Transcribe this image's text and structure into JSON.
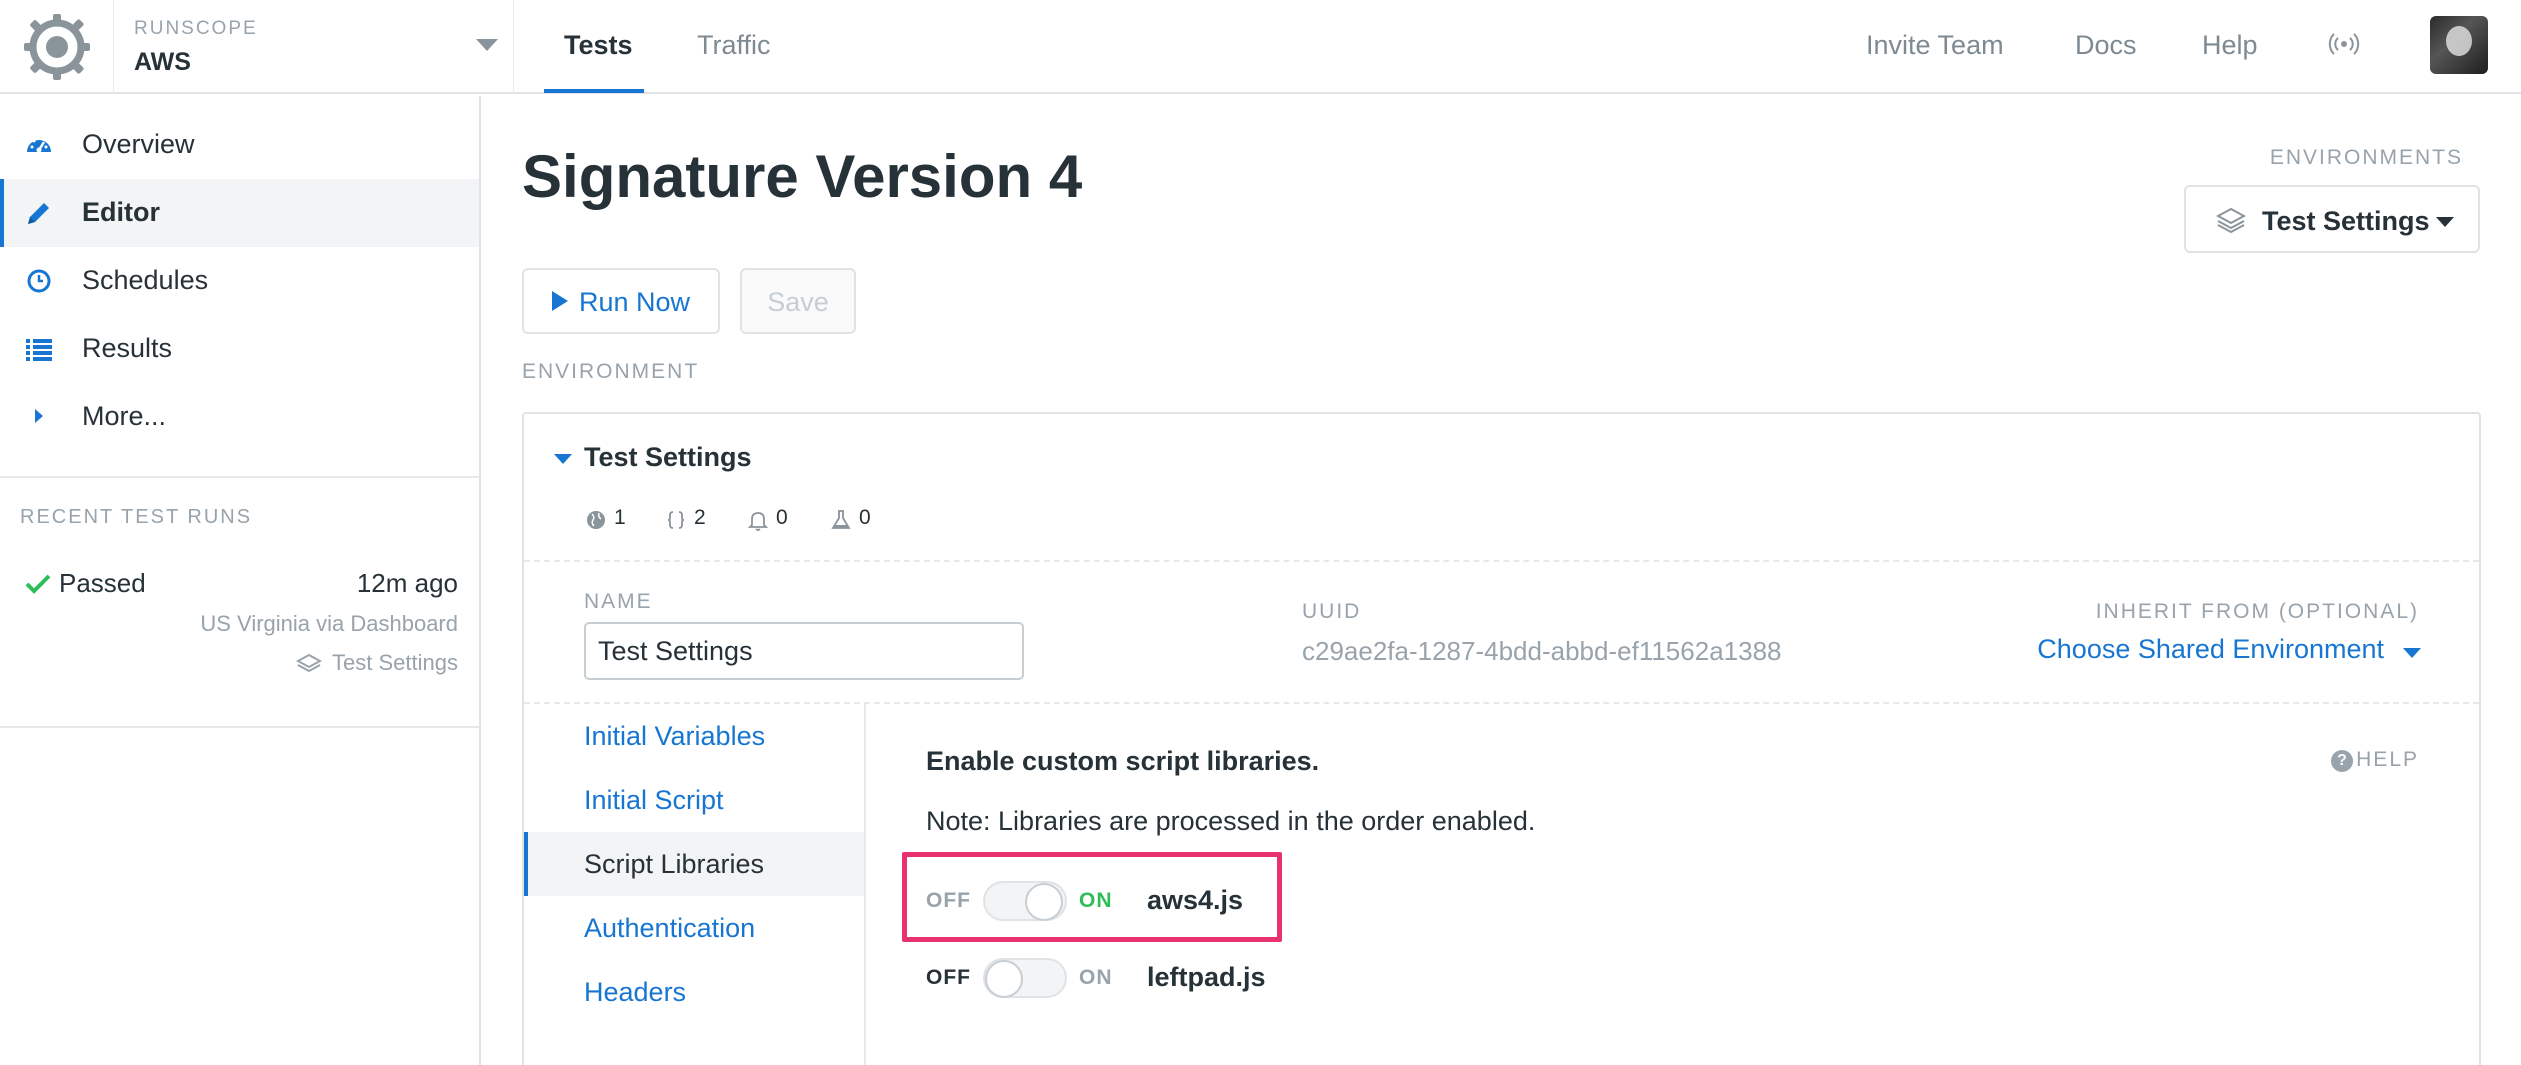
{
  "topbar": {
    "brand_small": "RUNSCOPE",
    "bucket_name": "AWS",
    "tabs": [
      {
        "label": "Tests",
        "active": true
      },
      {
        "label": "Traffic",
        "active": false
      }
    ],
    "links": {
      "invite": "Invite Team",
      "docs": "Docs",
      "help": "Help"
    }
  },
  "sidebar": {
    "items": [
      {
        "label": "Overview",
        "icon": "dashboard-icon"
      },
      {
        "label": "Editor",
        "icon": "pencil-icon",
        "active": true
      },
      {
        "label": "Schedules",
        "icon": "clock-icon"
      },
      {
        "label": "Results",
        "icon": "list-icon"
      },
      {
        "label": "More...",
        "icon": "caret-right-icon"
      }
    ],
    "recent_title": "RECENT TEST RUNS",
    "recent_run": {
      "status": "Passed",
      "time": "12m ago",
      "location": "US Virginia via Dashboard",
      "environment": "Test Settings"
    }
  },
  "main": {
    "title": "Signature Version 4",
    "environments_label": "ENVIRONMENTS",
    "env_select": "Test Settings",
    "run_label": "Run Now",
    "save_label": "Save",
    "environment_section": "ENVIRONMENT"
  },
  "panel": {
    "title": "Test Settings",
    "stats": {
      "regions": "1",
      "variables": "2",
      "notifications": "0",
      "tests": "0"
    },
    "name_label": "NAME",
    "name_value": "Test Settings",
    "uuid_label": "UUID",
    "uuid_value": "c29ae2fa-1287-4bdd-abbd-ef11562a1388",
    "inherit_label": "INHERIT FROM (OPTIONAL)",
    "inherit_link": "Choose Shared Environment",
    "subnav": [
      {
        "label": "Initial Variables"
      },
      {
        "label": "Initial Script"
      },
      {
        "label": "Script Libraries",
        "active": true
      },
      {
        "label": "Authentication"
      },
      {
        "label": "Headers"
      }
    ],
    "content_title": "Enable custom script libraries.",
    "help_label": "HELP",
    "note": "Note: Libraries are processed in the order enabled.",
    "libraries": [
      {
        "name": "aws4.js",
        "off_label": "OFF",
        "on_label": "ON",
        "enabled": true
      },
      {
        "name": "leftpad.js",
        "off_label": "OFF",
        "on_label": "ON",
        "enabled": false
      }
    ]
  },
  "colors": {
    "accent": "#1776d1",
    "success": "#2ebd59",
    "highlight": "#e8326d",
    "muted": "#98a3ab",
    "text": "#263238"
  }
}
